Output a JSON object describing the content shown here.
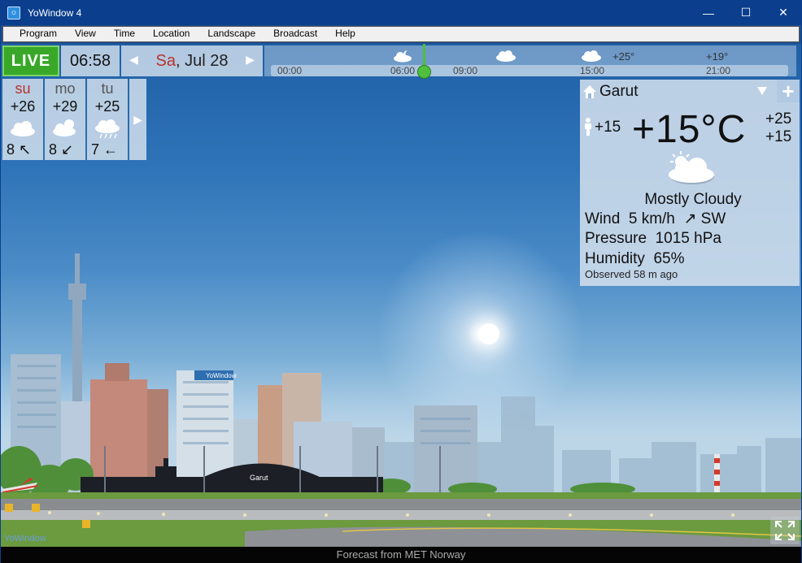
{
  "window": {
    "title": "YoWindow 4",
    "minimize": "—",
    "maximize": "☐",
    "close": "✕"
  },
  "menu": [
    "Program",
    "View",
    "Time",
    "Location",
    "Landscape",
    "Broadcast",
    "Help"
  ],
  "controls": {
    "live_label": "LIVE",
    "time": "06:58",
    "date_day": "Sa",
    "date_rest": ", Jul 28",
    "prev_arrow": "◀",
    "next_arrow": "▶"
  },
  "timeline": {
    "hours": [
      "00:00",
      "06:00",
      "09:00",
      "15:00",
      "21:00"
    ],
    "temps": [
      "+25°",
      "+19°"
    ]
  },
  "forecast": {
    "days": [
      {
        "day": "su",
        "temp": "+26",
        "wind": "8",
        "wind_arrow": "↖",
        "icon": "cloud-icon"
      },
      {
        "day": "mo",
        "temp": "+29",
        "wind": "8",
        "wind_arrow": "↙",
        "icon": "sun-cloud-icon"
      },
      {
        "day": "tu",
        "temp": "+25",
        "wind": "7",
        "wind_arrow": "←",
        "icon": "rain-cloud-icon"
      }
    ],
    "next_arrow": "▶"
  },
  "current": {
    "city": "Garut",
    "add_label": "+",
    "feels_like": "+15",
    "temperature": "+15°C",
    "high": "+25",
    "low": "+15",
    "condition": "Mostly Cloudy",
    "wind_label": "Wind",
    "wind_value": "5 km/h",
    "wind_arrow": "↗",
    "wind_dir": "SW",
    "pressure_label": "Pressure",
    "pressure_value": "1015 hPa",
    "humidity_label": "Humidity",
    "humidity_value": "65%",
    "observed": "Observed 58 m ago"
  },
  "scene": {
    "building_sign": "YoWindow",
    "terminal_sign": "Garut",
    "watermark": "YoWindow"
  },
  "footer": {
    "source": "Forecast from MET Norway"
  }
}
